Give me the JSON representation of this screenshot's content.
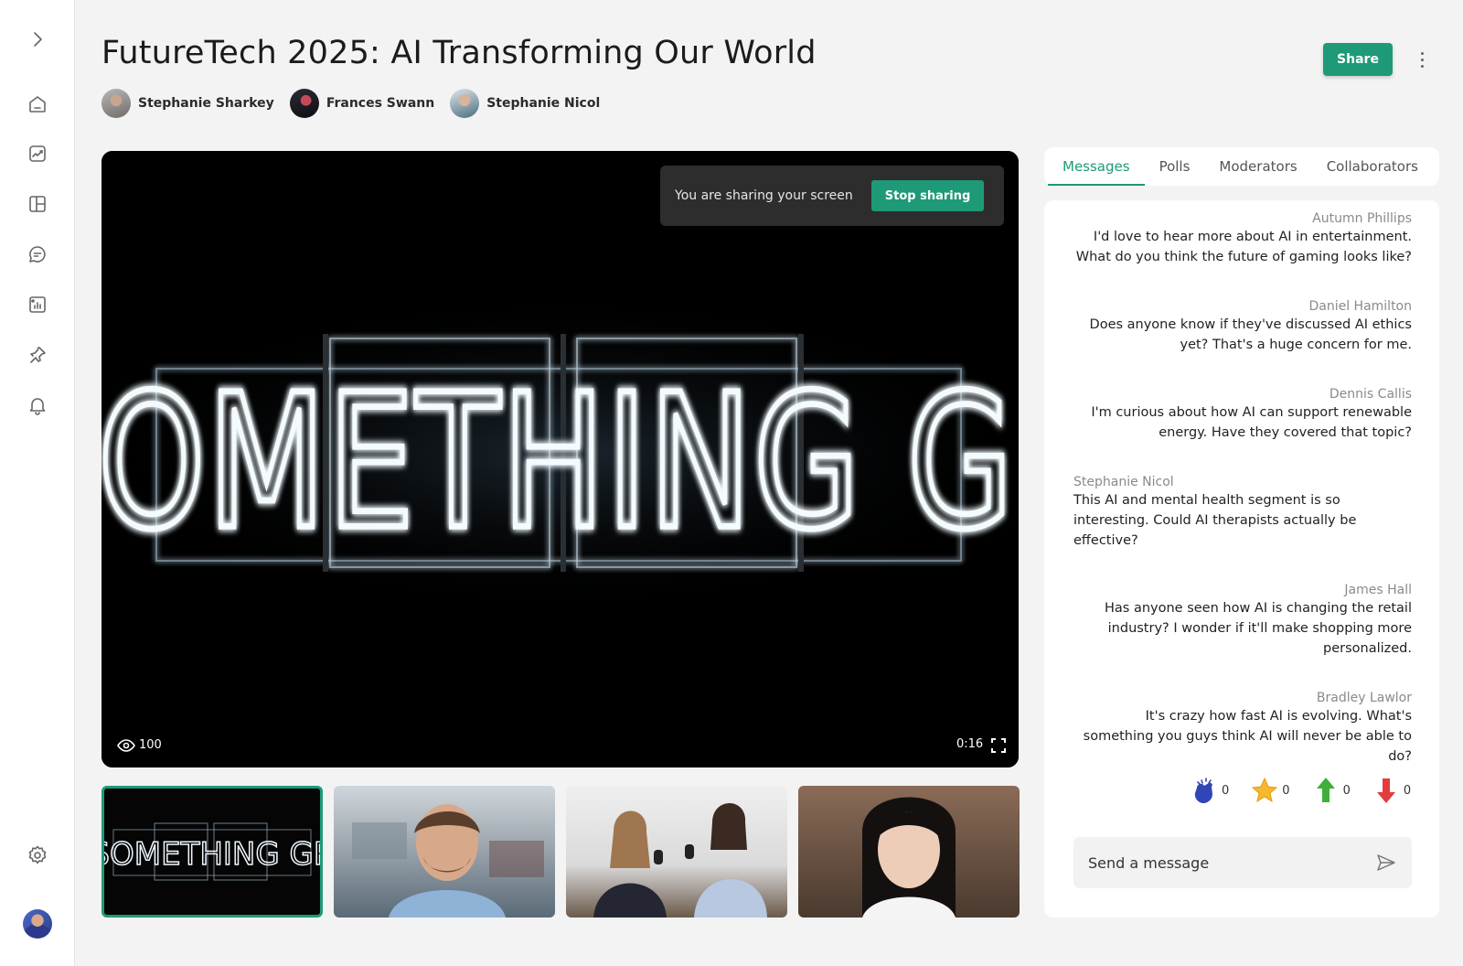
{
  "page": {
    "title": "FutureTech 2025: AI Transforming Our World"
  },
  "presenters": [
    {
      "name": "Stephanie Sharkey"
    },
    {
      "name": "Frances Swann"
    },
    {
      "name": "Stephanie Nicol"
    }
  ],
  "header": {
    "share_label": "Share"
  },
  "sidebar": {
    "icons": [
      "chevron-right-icon",
      "home-icon",
      "analytics-icon",
      "layout-icon",
      "chat-icon",
      "report-icon",
      "pin-icon",
      "bell-icon",
      "gear-icon"
    ]
  },
  "video": {
    "sharing_message": "You are sharing your screen",
    "stop_sharing_label": "Stop sharing",
    "views": "100",
    "time": "0:16",
    "neon_text": "DO SOMETHING GREAT"
  },
  "tabs": [
    {
      "label": "Messages",
      "active": true
    },
    {
      "label": "Polls",
      "active": false
    },
    {
      "label": "Moderators",
      "active": false
    },
    {
      "label": "Collaborators",
      "active": false
    }
  ],
  "messages": [
    {
      "author": "Autumn Phillips",
      "text": "I'd love to hear more about AI in entertainment. What do you think the future of gaming looks like?",
      "align": "right"
    },
    {
      "author": "Daniel Hamilton",
      "text": "Does anyone know if they've discussed AI ethics yet? That's a huge concern for me.",
      "align": "right"
    },
    {
      "author": "Dennis Callis",
      "text": "I'm curious about how AI can support renewable energy. Have they covered that topic?",
      "align": "right"
    },
    {
      "author": "Stephanie Nicol",
      "text": "This AI and mental health segment is so interesting. Could AI therapists actually be effective?",
      "align": "left"
    },
    {
      "author": "James Hall",
      "text": "Has anyone seen how AI is changing the retail industry? I wonder if it'll make shopping more personalized.",
      "align": "right"
    },
    {
      "author": "Bradley Lawlor",
      "text": "It's crazy how fast AI is evolving. What's something you guys think AI will never be able to do?",
      "align": "right"
    }
  ],
  "reactions": [
    {
      "icon": "clap-icon",
      "count": "0"
    },
    {
      "icon": "star-icon",
      "count": "0"
    },
    {
      "icon": "arrow-up-icon",
      "count": "0"
    },
    {
      "icon": "arrow-down-icon",
      "count": "0"
    }
  ],
  "composer": {
    "placeholder": "Send a message"
  },
  "colors": {
    "accent": "#1e9a78",
    "background": "#f3f3f3"
  }
}
